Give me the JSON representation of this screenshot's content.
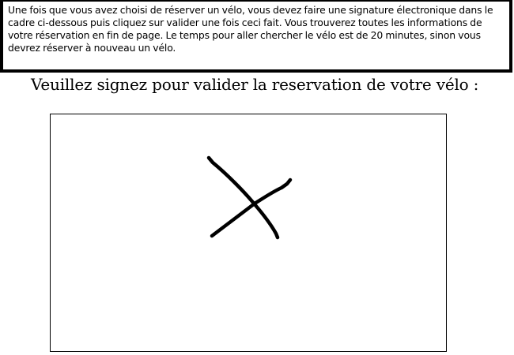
{
  "instructions": {
    "text": "Une fois que vous avez choisi de réserver un vélo, vous devez faire une signature électronique dans le cadre ci-dessous puis cliquez sur valider une fois ceci fait. Vous trouverez toutes les informations de votre réservation en fin de page. Le temps pour aller chercher le vélo est de 20 minutes, sinon vous devrez réserver à nouveau un vélo."
  },
  "heading": {
    "text": "Veuillez signez pour valider la reservation de votre vélo :"
  },
  "signature_pad": {
    "stroke_color": "#000000",
    "background_color": "#ffffff"
  }
}
